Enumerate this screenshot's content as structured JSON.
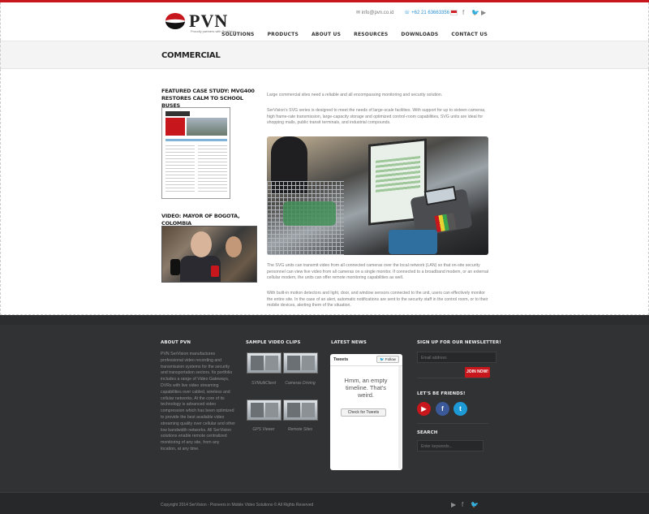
{
  "header": {
    "logo_text": "PVN",
    "logo_tagline": "Proudly partners with SerVision",
    "email": "info@pvn.co.id",
    "phone": "+62 21 63663356",
    "social_icons": [
      "youtube-icon",
      "twitter-icon",
      "facebook-icon"
    ],
    "nav": [
      "SOLUTIONS",
      "PRODUCTS",
      "ABOUT US",
      "RESOURCES",
      "DOWNLOADS",
      "CONTACT US"
    ]
  },
  "page": {
    "title": "COMMERCIAL"
  },
  "sidebar": {
    "case_study_title": "FEATURED CASE STUDY: MVG400 RESTORES CALM TO SCHOOL BUSES",
    "case_study_doc_header": "SerVision",
    "video_title": "VIDEO: MAYOR OF BOGOTA, COLOMBIA"
  },
  "main": {
    "p1": "Large commercial sites need a reliable and all encompassing monitoring and security solution.",
    "p2": "SerVision's SVG series is designed to meet the needs of large-scale facilities. With support for up to sixteen cameras, high frame-rate transmission, large-capacity storage and optimized control-room capabilities, SVG units are ideal for shopping malls, public transit terminals, and industrial compounds.",
    "p3": "The SVG units can transmit video from all connected cameras over the local network (LAN) so that on-site security personnel can view live video from all cameras on a single monitor. If connected to a broadband modem, or an external cellular modem, the units can offer remote monitoring capabilities as well.",
    "p4": "With built-in motion detectors and light, door, and window sensors connected to the unit, users can effectively monitor the entire site. In the case of an alert, automatic notifications are sent to the security staff in the control room, or to their mobile devices, alerting them of the situation."
  },
  "footer": {
    "about_title": "ABOUT PVN",
    "about_text": "PVN SerVision manufactures professional video recording and transmission systems for the security and transportation sectors. Its portfolio includes a range of Video Gateways, DVRs with live video streaming capabilities over cabled, wireless and cellular networks. At the core of its technology is advanced video compression which has been optimized to provide the best available video streaming quality over cellular and other low bandwidth networks. All SerVision solutions enable remote centralized monitoring of any site, from any location, at any time.",
    "clips_title": "SAMPLE VIDEO CLIPS",
    "clips": [
      "SVMultiClient",
      "Cameras Driving",
      "GPS Viewer",
      "Remote Sites"
    ],
    "news_title": "LATEST NEWS",
    "tweets_label": "Tweets",
    "follow_label": "Follow",
    "empty_timeline": "Hmm, an empty timeline. That's weird.",
    "check_tweets": "Check for Tweets",
    "newsletter_title": "SIGN UP FOR OUR NEWSLETTER!",
    "email_placeholder": "Email address",
    "join_label": "JOIN NOW!",
    "friends_title": "LET'S BE FRIENDS!",
    "search_title": "SEARCH",
    "search_placeholder": "Enter keywords...",
    "copyright": "Copyright 2014 SerVision - Pioneers in Mobile Video Solutions © All Rights Reserved"
  },
  "colors": {
    "accent": "#c8161d",
    "footer_bg": "#303234",
    "twitter": "#1d9ad6",
    "facebook": "#3b5998",
    "youtube": "#c8161d"
  }
}
